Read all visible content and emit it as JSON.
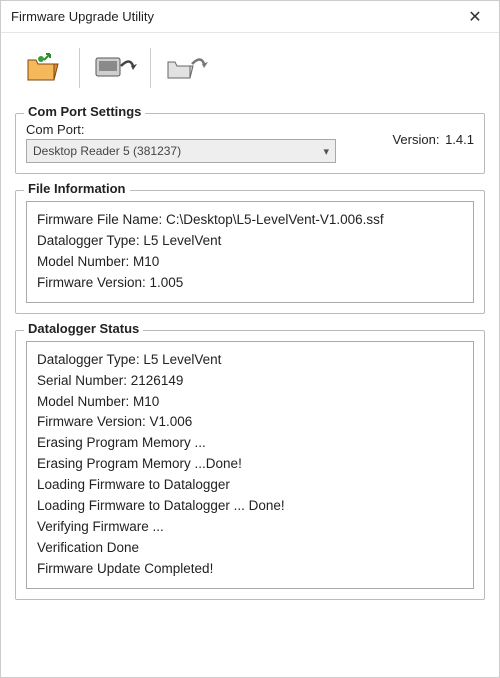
{
  "window": {
    "title": "Firmware Upgrade Utility"
  },
  "toolbar": {
    "open_icon": "open-file-icon",
    "upload_icon": "upload-firmware-icon",
    "load_icon": "load-firmware-icon"
  },
  "comport": {
    "group_title": "Com Port Settings",
    "label": "Com Port:",
    "selected": "Desktop Reader 5 (381237)",
    "version_label": "Version:",
    "version_value": "1.4.1"
  },
  "file_info": {
    "group_title": "File Information",
    "lines": [
      "Firmware File Name: C:\\Desktop\\L5-LevelVent-V1.006.ssf",
      "Datalogger Type: L5 LevelVent",
      "Model Number: M10",
      "Firmware Version: 1.005"
    ]
  },
  "status": {
    "group_title": "Datalogger Status",
    "lines": [
      "Datalogger Type: L5 LevelVent",
      "Serial Number: 2126149",
      "Model Number: M10",
      "Firmware Version: V1.006",
      "Erasing Program Memory ...",
      "Erasing Program Memory ...Done!",
      "Loading Firmware to Datalogger",
      "Loading Firmware to Datalogger ... Done!",
      "Verifying Firmware ...",
      "Verification Done",
      "Firmware Update Completed!"
    ]
  }
}
